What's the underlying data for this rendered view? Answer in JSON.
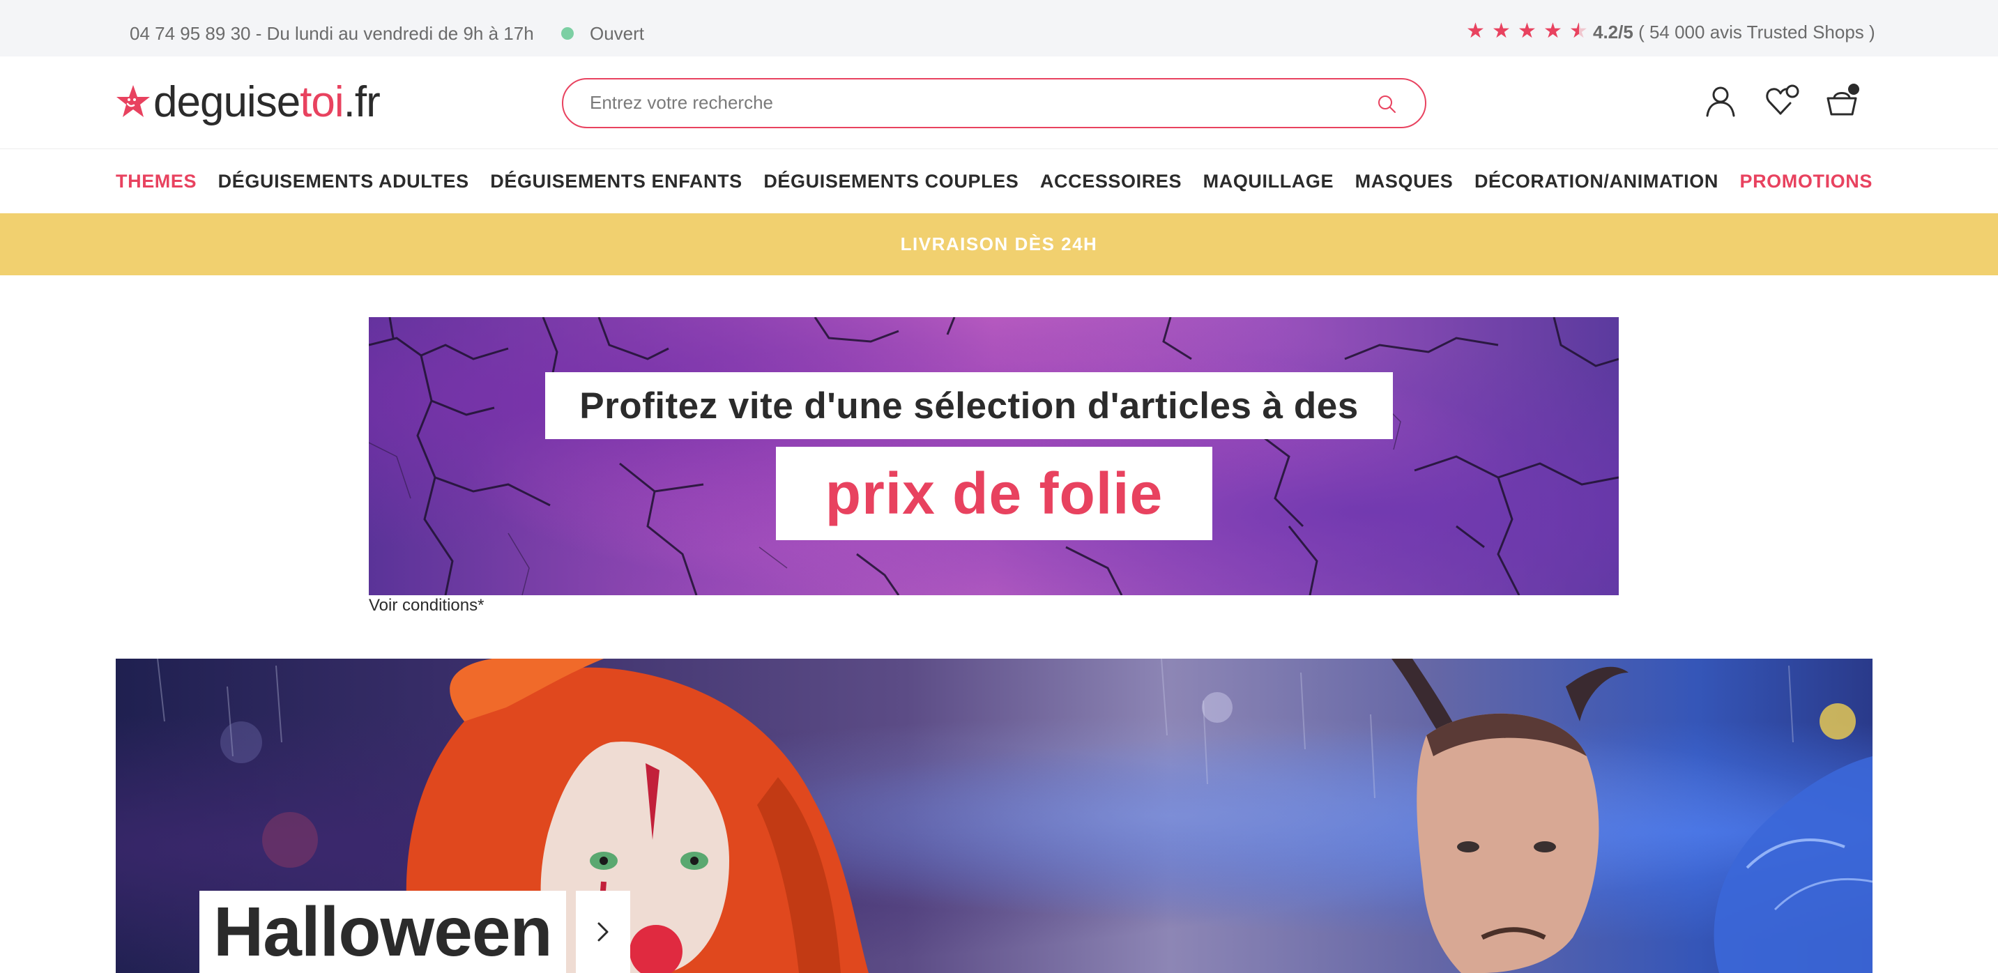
{
  "topbar": {
    "phone_hours": "04 74 95 89 30 - Du lundi au vendredi de 9h à 17h",
    "status": "Ouvert",
    "status_color": "#7ccfa3",
    "rating_stars": 4.5,
    "rating_value": "4.2/5",
    "rating_text": "( 54 000 avis Trusted Shops )"
  },
  "header": {
    "logo_main": "deguise",
    "logo_accent": "toi",
    "logo_suffix": ".fr",
    "search_placeholder": "Entrez votre recherche",
    "icons": [
      "user-icon",
      "heart-icon",
      "basket-icon"
    ]
  },
  "nav": {
    "items": [
      {
        "label": "THEMES",
        "highlight": true
      },
      {
        "label": "DÉGUISEMENTS ADULTES",
        "highlight": false
      },
      {
        "label": "DÉGUISEMENTS ENFANTS",
        "highlight": false
      },
      {
        "label": "DÉGUISEMENTS COUPLES",
        "highlight": false
      },
      {
        "label": "ACCESSOIRES",
        "highlight": false
      },
      {
        "label": "MAQUILLAGE",
        "highlight": false
      },
      {
        "label": "MASQUES",
        "highlight": false
      },
      {
        "label": "DÉCORATION/ANIMATION",
        "highlight": false
      },
      {
        "label": "PROMOTIONS",
        "highlight": true
      }
    ]
  },
  "strip": {
    "text": "LIVRAISON DÈS 24H",
    "color": "#f1d06f"
  },
  "promo": {
    "line1": "Profitez vite d'une sélection d'articles à des",
    "line2": "prix de folie",
    "conditions": "Voir conditions*"
  },
  "hero": {
    "title": "Halloween"
  },
  "colors": {
    "brand": "#e8425f",
    "text": "#2b2b2b"
  }
}
